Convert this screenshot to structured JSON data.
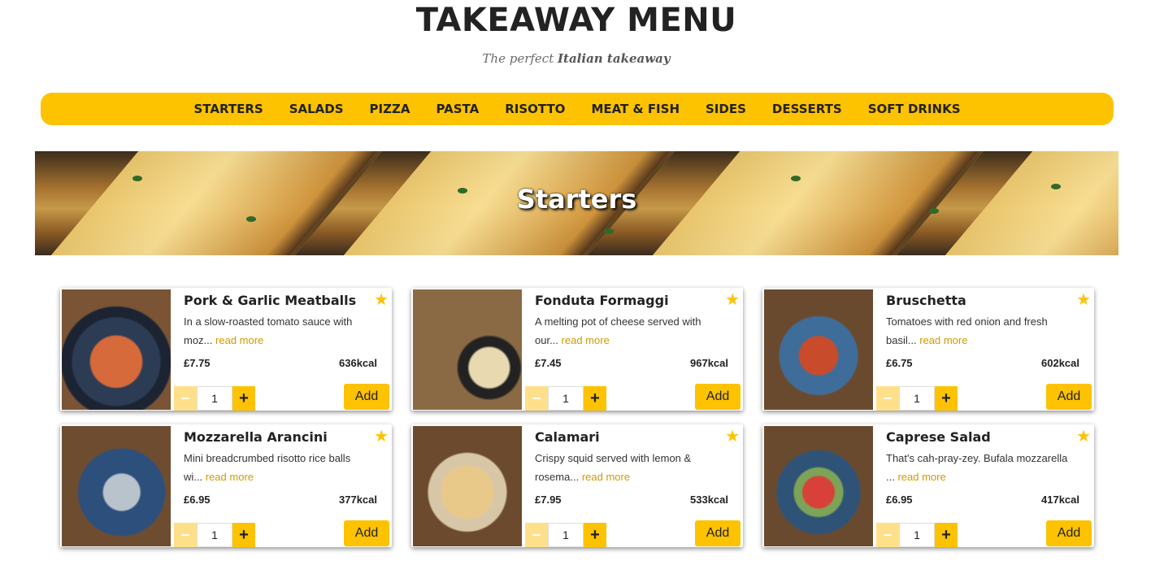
{
  "header": {
    "title": "TAKEAWAY MENU",
    "subtitle_prefix": "The perfect ",
    "subtitle_bold": "Italian takeaway"
  },
  "nav": {
    "items": [
      "STARTERS",
      "SALADS",
      "PIZZA",
      "PASTA",
      "RISOTTO",
      "MEAT & FISH",
      "SIDES",
      "DESSERTS",
      "SOFT DRINKS"
    ]
  },
  "banner": {
    "title": "Starters"
  },
  "colors": {
    "accent": "#fdc200",
    "link": "#d19a00"
  },
  "common": {
    "read_more": "read more",
    "add_label": "Add",
    "minus_label": "−",
    "plus_label": "+",
    "star_icon": "star-icon"
  },
  "items": [
    {
      "name": "Pork & Garlic Meatballs",
      "desc": "In a slow-roasted tomato sauce with moz...",
      "price": "£7.75",
      "kcal": "636kcal",
      "qty": "1"
    },
    {
      "name": "Fonduta Formaggi",
      "desc": "A melting pot of cheese served with our...",
      "price": "£7.45",
      "kcal": "967kcal",
      "qty": "1"
    },
    {
      "name": "Bruschetta",
      "desc": "Tomatoes with red onion and fresh basil...",
      "price": "£6.75",
      "kcal": "602kcal",
      "qty": "1"
    },
    {
      "name": "Mozzarella Arancini",
      "desc": "Mini breadcrumbed risotto rice balls wi...",
      "price": "£6.95",
      "kcal": "377kcal",
      "qty": "1"
    },
    {
      "name": "Calamari",
      "desc": "Crispy squid served with lemon & rosema...",
      "price": "£7.95",
      "kcal": "533kcal",
      "qty": "1"
    },
    {
      "name": "Caprese Salad",
      "desc": "That's cah-pray-zey. Bufala mozzarella ...",
      "price": "£6.95",
      "kcal": "417kcal",
      "qty": "1"
    }
  ]
}
